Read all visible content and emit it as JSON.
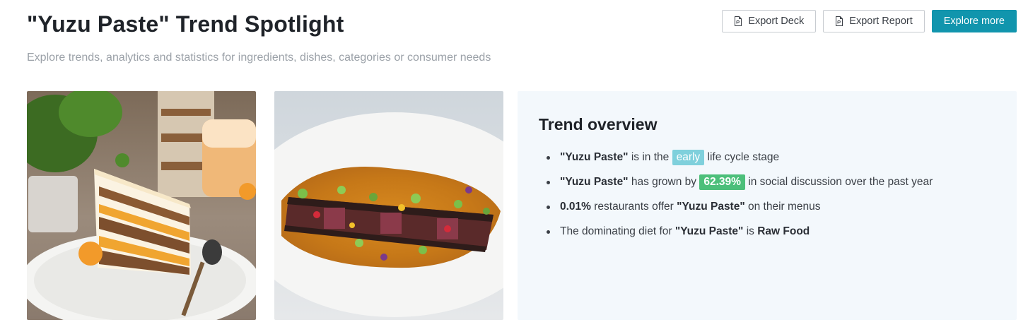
{
  "header": {
    "title": "\"Yuzu Paste\" Trend Spotlight",
    "subtitle": "Explore trends, analytics and statistics for ingredients, dishes, categories or consumer needs"
  },
  "actions": {
    "export_deck": "Export Deck",
    "export_report": "Export Report",
    "explore_more": "Explore more"
  },
  "overview": {
    "title": "Trend overview",
    "items": [
      {
        "a": "\"Yuzu Paste\"",
        "b": " is in the ",
        "tag": "early",
        "c": " life cycle stage"
      },
      {
        "a": "\"Yuzu Paste\"",
        "b": " has grown by ",
        "tag": "62.39%",
        "c": " in social discussion over the past year"
      },
      {
        "a": "0.01%",
        "b": " restaurants offer ",
        "c": "\"Yuzu Paste\"",
        "d": " on their menus"
      },
      {
        "a": "The dominating diet for ",
        "b": "\"Yuzu Paste\"",
        "c": " is ",
        "d": "Raw Food"
      }
    ]
  },
  "colors": {
    "primary": "#1195ad",
    "tag_early": "#7fd0dc",
    "tag_growth": "#4cbf7a",
    "panel_bg": "#f3f8fc"
  },
  "images": {
    "image_1_icon": "cake-photo",
    "image_2_icon": "seared-tuna-dish-photo"
  }
}
